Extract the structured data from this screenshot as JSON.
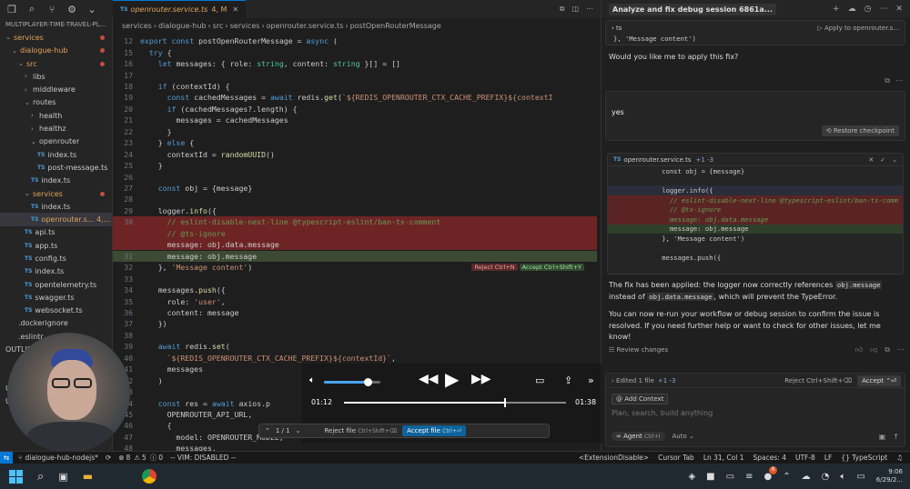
{
  "explorer": {
    "root": "MULTIPLAYER-TIME-TRAVEL-PL...",
    "items": [
      {
        "label": "services",
        "indent": 0,
        "chev": "⌄",
        "orange": true,
        "dot": true
      },
      {
        "label": "dialogue-hub",
        "indent": 1,
        "chev": "⌄",
        "orange": true,
        "dot": true
      },
      {
        "label": "src",
        "indent": 2,
        "chev": "⌄",
        "orange": true,
        "dot": true
      },
      {
        "label": "libs",
        "indent": 3,
        "chev": "›"
      },
      {
        "label": "middleware",
        "indent": 3,
        "chev": "›"
      },
      {
        "label": "routes",
        "indent": 3,
        "chev": "⌄"
      },
      {
        "label": "health",
        "indent": 4,
        "chev": "›"
      },
      {
        "label": "healthz",
        "indent": 4,
        "chev": "›"
      },
      {
        "label": "openrouter",
        "indent": 4,
        "chev": "⌄"
      },
      {
        "label": "index.ts",
        "indent": 5,
        "ts": true
      },
      {
        "label": "post-message.ts",
        "indent": 5,
        "ts": true
      },
      {
        "label": "index.ts",
        "indent": 4,
        "ts": true
      },
      {
        "label": "services",
        "indent": 3,
        "chev": "⌄",
        "orange": true,
        "dot": true
      },
      {
        "label": "index.ts",
        "indent": 4,
        "ts": true
      },
      {
        "label": "openrouter.s... 4, M",
        "indent": 4,
        "ts": true,
        "orange": true,
        "sel": true
      },
      {
        "label": "api.ts",
        "indent": 3,
        "ts": true
      },
      {
        "label": "app.ts",
        "indent": 3,
        "ts": true
      },
      {
        "label": "config.ts",
        "indent": 3,
        "ts": true
      },
      {
        "label": "index.ts",
        "indent": 3,
        "ts": true
      },
      {
        "label": "opentelemetry.ts",
        "indent": 3,
        "ts": true
      },
      {
        "label": "swagger.ts",
        "indent": 3,
        "ts": true
      },
      {
        "label": "websocket.ts",
        "indent": 3,
        "ts": true
      },
      {
        "label": ".dockerignore",
        "indent": 2
      },
      {
        "label": ".eslintr...",
        "indent": 2
      },
      {
        "label": "OUTLINE",
        "indent": 0
      },
      {
        "label": "",
        "indent": 0
      },
      {
        "label": "",
        "indent": 0
      },
      {
        "label": "U...",
        "indent": 0
      },
      {
        "label": "Undo...",
        "indent": 0
      },
      {
        "label": "",
        "indent": 0
      }
    ]
  },
  "tab": {
    "label": "openrouter.service.ts",
    "badge": "4, M"
  },
  "breadcrumb": [
    "services",
    "dialogue-hub",
    "src",
    "services",
    "openrouter.service.ts",
    "postOpenRouterMessage"
  ],
  "code": [
    {
      "n": "12",
      "t": "export const postOpenRouterMessage = async ("
    },
    {
      "n": "15",
      "t": "  try {"
    },
    {
      "n": "16",
      "t": "    let messages: { role: string, content: string }[] = []"
    },
    {
      "n": "17",
      "t": ""
    },
    {
      "n": "18",
      "t": "    if (contextId) {"
    },
    {
      "n": "19",
      "t": "      const cachedMessages = await redis.get(`${REDIS_OPENROUTER_CTX_CACHE_PREFIX}${contextI"
    },
    {
      "n": "20",
      "t": "      if (cachedMessages?.length) {"
    },
    {
      "n": "21",
      "t": "        messages = cachedMessages"
    },
    {
      "n": "22",
      "t": "      }"
    },
    {
      "n": "23",
      "t": "    } else {"
    },
    {
      "n": "24",
      "t": "      contextId = randomUUID()"
    },
    {
      "n": "25",
      "t": "    }"
    },
    {
      "n": "26",
      "t": ""
    },
    {
      "n": "27",
      "t": "    const obj = {message}"
    },
    {
      "n": "28",
      "t": ""
    },
    {
      "n": "29",
      "t": "    logger.info({"
    },
    {
      "n": "30",
      "t": "      // eslint-disable-next-line @typescript-eslint/ban-ts-comment",
      "cls": "del"
    },
    {
      "n": "",
      "t": "      // @ts-ignore",
      "cls": "del"
    },
    {
      "n": "",
      "t": "      message: obj.data.message",
      "cls": "del"
    },
    {
      "n": "31",
      "t": "      message: obj.message",
      "cls": "add"
    },
    {
      "n": "32",
      "t": "    }, 'Message content')"
    },
    {
      "n": "33",
      "t": ""
    },
    {
      "n": "34",
      "t": "    messages.push({"
    },
    {
      "n": "35",
      "t": "      role: 'user',"
    },
    {
      "n": "36",
      "t": "      content: message"
    },
    {
      "n": "37",
      "t": "    })"
    },
    {
      "n": "38",
      "t": ""
    },
    {
      "n": "39",
      "t": "    await redis.set("
    },
    {
      "n": "40",
      "t": "      `${REDIS_OPENROUTER_CTX_CACHE_PREFIX}${contextId}`,"
    },
    {
      "n": "41",
      "t": "      messages"
    },
    {
      "n": "42",
      "t": "    )"
    },
    {
      "n": "43",
      "t": ""
    },
    {
      "n": "44",
      "t": "    const res = await axios.p"
    },
    {
      "n": "45",
      "t": "      OPENROUTER_API_URL,"
    },
    {
      "n": "46",
      "t": "      {"
    },
    {
      "n": "47",
      "t": "        model: OPENROUTER_MODEL,"
    },
    {
      "n": "48",
      "t": "        messages,"
    }
  ],
  "inline": {
    "reject": "Reject Ctrl+N",
    "accept": "Accept Ctrl+Shift+Y"
  },
  "review_bar": {
    "count": "1 / 1",
    "reject": "Reject file",
    "reject_key": "Ctrl+Shift+⌫",
    "accept": "Accept file",
    "accept_key": "Ctrl+⏎"
  },
  "media": {
    "elapsed": "01:12",
    "total": "01:38",
    "progress": 0.72,
    "volume": 0.78
  },
  "panel": {
    "title": "Analyze and fix debug session 6861a...",
    "snippet_lang": "ts",
    "snippet_apply": "Apply to openrouter.s...",
    "snippet_line": "}, 'Message content')",
    "question": "Would you like me to apply this fix?",
    "user_msg": "yes",
    "restore": "Restore checkpoint",
    "diff_file": "openrouter.service.ts",
    "diff_stat": "+1 -3",
    "diff": [
      {
        "t": "    const obj = {message}",
        "cls": ""
      },
      {
        "t": "",
        "cls": ""
      },
      {
        "t": "    logger.info({",
        "cls": "sel"
      },
      {
        "t": "      // eslint-disable-next-line @typescript-eslint/ban-ts-comm",
        "cls": "del"
      },
      {
        "t": "      // @ts-ignore",
        "cls": "del"
      },
      {
        "t": "      message: obj.data.message",
        "cls": "del"
      },
      {
        "t": "      message: obj.message",
        "cls": "add"
      },
      {
        "t": "    }, 'Message content')",
        "cls": ""
      },
      {
        "t": "",
        "cls": ""
      },
      {
        "t": "    messages.push({",
        "cls": ""
      }
    ],
    "answer1_a": "The fix has been applied: the logger now correctly references ",
    "answer1_code1": "obj.message",
    "answer1_b": " instead of ",
    "answer1_code2": "obj.data.message",
    "answer1_c": ", which will prevent the TypeError.",
    "answer2": "You can now re-run your workflow or debug session to confirm the issue is resolved. If you need further help or want to check for other issues, let me know!",
    "review_changes": "Review changes",
    "edited": "Edited 1 file",
    "edited_stat": "+1 -3",
    "reject_all": "Reject Ctrl+Shift+⌫",
    "accept_all": "Accept ⌃⏎",
    "add_context": "Add Context",
    "placeholder": "Plan, search, build anything",
    "agent": "Agent",
    "agent_key": "Ctrl+I",
    "auto": "Auto"
  },
  "status": {
    "left": "dialogue-hub-nodejs*",
    "errors": "8",
    "warnings": "5",
    "info": "0",
    "vim": "-- VIM: DISABLED --",
    "ext": "<ExtensionDisable>",
    "cursor_tab": "Cursor Tab",
    "pos": "Ln 31, Col 1",
    "spaces": "Spaces: 4",
    "enc": "UTF-8",
    "eol": "LF",
    "lang": "{} TypeScript"
  },
  "taskbar": {
    "time": "9:06",
    "date": "6/29/2...",
    "badge": "6"
  },
  "colors": {
    "accent": "#0078d4",
    "del": "#6e2424",
    "add": "#3c4a33",
    "modified": "#e2a35a"
  }
}
